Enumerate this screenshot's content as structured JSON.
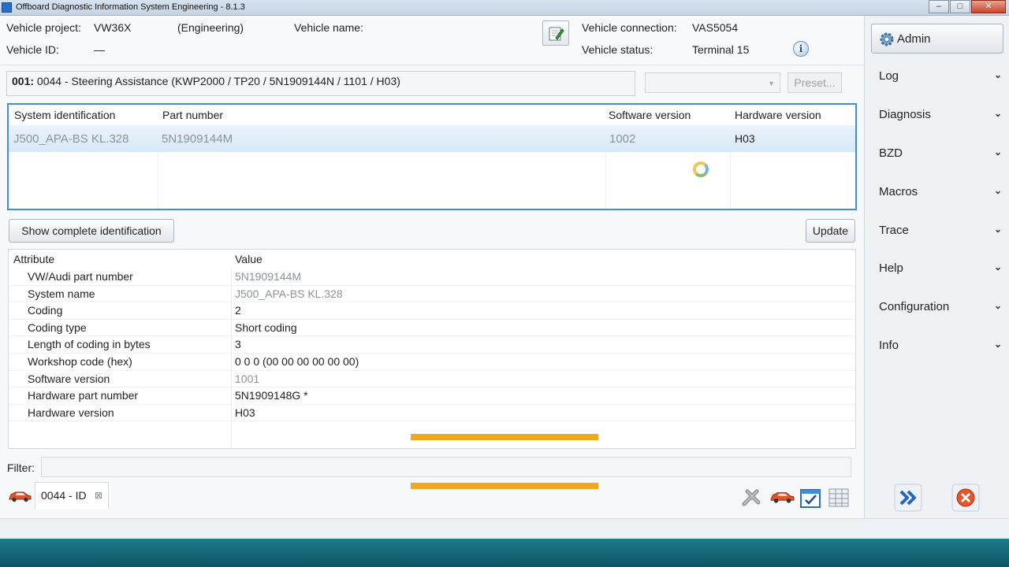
{
  "window": {
    "title": "Offboard Diagnostic Information System Engineering - 8.1.3",
    "buttons": {
      "minimize": "–",
      "maximize": "□",
      "close": "✕"
    }
  },
  "vehicle": {
    "project_label": "Vehicle project:",
    "project_value": "VW36X",
    "mode": "(Engineering)",
    "name_label": "Vehicle name:",
    "id_label": "Vehicle ID:",
    "id_value": "—",
    "connection_label": "Vehicle connection:",
    "connection_value": "VAS5054",
    "status_label": "Vehicle status:",
    "status_value": "Terminal 15",
    "info_icon": "i"
  },
  "ecu": {
    "number": "001:",
    "description": "0044 - Steering Assistance  (KWP2000 / TP20 / 5N1909144N / 1101 / H03)",
    "preset_label": "Preset..."
  },
  "identification": {
    "columns": [
      "System identification",
      "Part number",
      "Software version",
      "Hardware version"
    ],
    "row": {
      "system_identification": "J500_APA-BS KL.328",
      "part_number": "5N1909144M",
      "software_version": "1002",
      "hardware_version": "H03"
    }
  },
  "actions": {
    "show_complete": "Show complete identification",
    "update": "Update"
  },
  "attributes": {
    "columns": [
      "Attribute",
      "Value"
    ],
    "rows": [
      {
        "attribute": "VW/Audi part number",
        "value": "5N1909144M"
      },
      {
        "attribute": "System name",
        "value": "J500_APA-BS KL.328"
      },
      {
        "attribute": "Coding",
        "value": "2"
      },
      {
        "attribute": "Coding type",
        "value": "Short coding"
      },
      {
        "attribute": "Length of coding in bytes",
        "value": "3"
      },
      {
        "attribute": "Workshop code (hex)",
        "value": "0 0 0 (00 00 00 00 00 00)"
      },
      {
        "attribute": "Software version",
        "value": "1001"
      },
      {
        "attribute": "Hardware part number",
        "value": "5N1909148G  *"
      },
      {
        "attribute": "Hardware version",
        "value": "H03"
      }
    ]
  },
  "filter": {
    "label": "Filter:",
    "value": ""
  },
  "tabs": [
    {
      "label": "0044 - ID",
      "close": "⊠"
    }
  ],
  "sidebar": {
    "admin_label": "Admin",
    "items": [
      {
        "label": "Log"
      },
      {
        "label": "Diagnosis"
      },
      {
        "label": "BZD"
      },
      {
        "label": "Macros"
      },
      {
        "label": "Trace"
      },
      {
        "label": "Help"
      },
      {
        "label": "Configuration"
      },
      {
        "label": "Info"
      }
    ],
    "chevron": "❯"
  },
  "colors": {
    "accent": "#3f8fd6",
    "highlight": "#f2a81e",
    "taskbar": "#0e5463"
  }
}
